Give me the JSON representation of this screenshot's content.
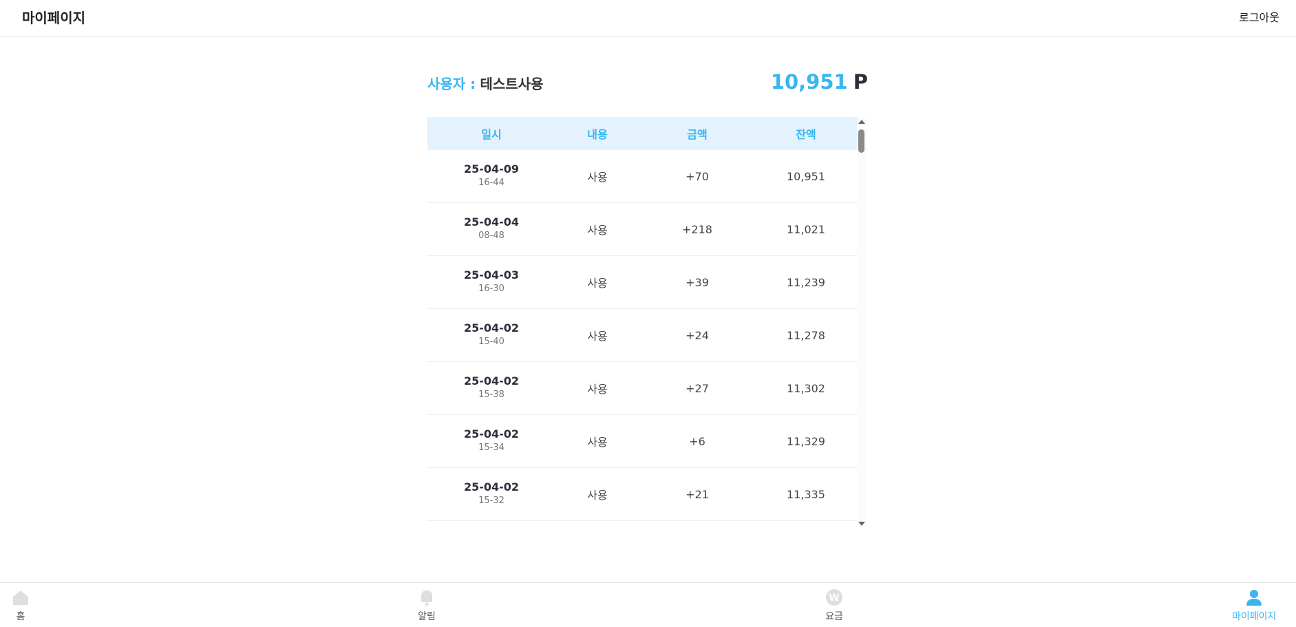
{
  "header": {
    "title": "마이페이지",
    "logout_label": "로그아웃"
  },
  "summary": {
    "user_label": "사용자 :",
    "user_name": "테스트사용",
    "points_value": "10,951",
    "points_unit": "P"
  },
  "colors": {
    "accent": "#38b6f0",
    "header_bg": "#e3f2fd",
    "dark_text": "#2b2f3a"
  },
  "table": {
    "headers": [
      "일시",
      "내용",
      "금액",
      "잔액"
    ],
    "rows": [
      {
        "date": "25-04-09",
        "time": "16-44",
        "desc": "사용",
        "amount": "+70",
        "balance": "10,951"
      },
      {
        "date": "25-04-04",
        "time": "08-48",
        "desc": "사용",
        "amount": "+218",
        "balance": "11,021"
      },
      {
        "date": "25-04-03",
        "time": "16-30",
        "desc": "사용",
        "amount": "+39",
        "balance": "11,239"
      },
      {
        "date": "25-04-02",
        "time": "15-40",
        "desc": "사용",
        "amount": "+24",
        "balance": "11,278"
      },
      {
        "date": "25-04-02",
        "time": "15-38",
        "desc": "사용",
        "amount": "+27",
        "balance": "11,302"
      },
      {
        "date": "25-04-02",
        "time": "15-34",
        "desc": "사용",
        "amount": "+6",
        "balance": "11,329"
      },
      {
        "date": "25-04-02",
        "time": "15-32",
        "desc": "사용",
        "amount": "+21",
        "balance": "11,335"
      }
    ]
  },
  "bottom_nav": [
    {
      "label": "홈",
      "icon": "home-icon",
      "active": false
    },
    {
      "label": "알림",
      "icon": "bell-icon",
      "active": false
    },
    {
      "label": "요금",
      "icon": "won-coin-icon",
      "active": false
    },
    {
      "label": "마이페이지",
      "icon": "user-icon",
      "active": true
    }
  ]
}
